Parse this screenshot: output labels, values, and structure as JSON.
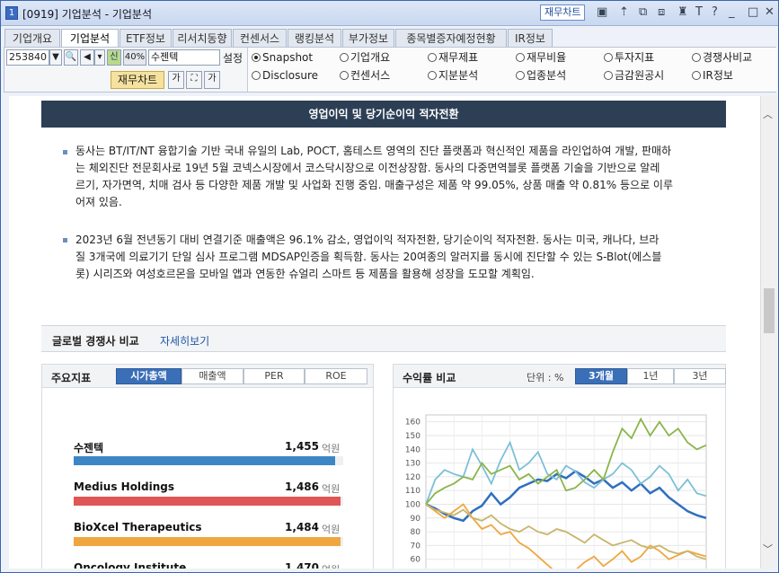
{
  "window": {
    "number": "1",
    "title": "[0919] 기업분석 - 기업분석",
    "finance_chart_btn": "재무차트",
    "icons": [
      "chart-icon",
      "link-icon",
      "tile-icon",
      "window-icon",
      "pin-icon",
      "text-icon",
      "help-icon",
      "minimize-icon",
      "maximize-icon",
      "close-icon"
    ],
    "icon_glyphs": [
      "▣",
      "⇡",
      "⧉",
      "⧈",
      "♜",
      "T",
      "?",
      "_",
      "□",
      "✕"
    ]
  },
  "tabs": [
    "기업개요",
    "기업분석",
    "ETF정보",
    "리서치동향",
    "컨센서스",
    "랭킹분석",
    "부가정보",
    "종목별증자예정현황",
    "IR정보"
  ],
  "toolbar": {
    "code": "253840",
    "badge_new": "신",
    "percent": "40%",
    "stock_name": "수젠텍",
    "settings": "설정",
    "finance_chart": "재무차트"
  },
  "radios": [
    {
      "label": "Snapshot",
      "checked": true
    },
    {
      "label": "기업개요",
      "checked": false
    },
    {
      "label": "재무제표",
      "checked": false
    },
    {
      "label": "재무비율",
      "checked": false
    },
    {
      "label": "투자지표",
      "checked": false
    },
    {
      "label": "경쟁사비교",
      "checked": false
    },
    {
      "label": "Disclosure",
      "checked": false
    },
    {
      "label": "컨센서스",
      "checked": false
    },
    {
      "label": "지분분석",
      "checked": false
    },
    {
      "label": "업종분석",
      "checked": false
    },
    {
      "label": "금감원공시",
      "checked": false
    },
    {
      "label": "IR정보",
      "checked": false
    }
  ],
  "section": {
    "title": "영업이익 및 당기순이익 적자전환",
    "para1": [
      "동사는 BT/IT/NT 융합기술 기반 국내 유일의 Lab, POCT, 홈테스트 영역의 진단 플랫폼과 혁신적인 제품을 라인업하여 개발, 판매하",
      "는 체외진단 전문회사로 19년 5월 코넥스시장에서 코스닥시장으로 이전상장함. 동사의 다중면역블롯 플랫폼 기술을 기반으로 알레",
      "르기, 자가면역, 치매 검사 등 다양한 제품 개발 및 사업화 진행 중임. 매출구성은 제품 약 99.05%, 상품 매출 약 0.81% 등으로 이루",
      "어져 있음."
    ],
    "para2": [
      "2023년 6월 전년동기 대비 연결기준 매출액은 96.1% 감소, 영업이익 적자전환, 당기순이익 적자전환. 동사는 미국, 캐나다, 브라",
      "질 3개국에 의료기기 단일 심사 프로그램 MDSAP인증을 획득함. 동사는 20여종의 알러지를 동시에 진단할 수 있는 S-Blot(에스블",
      "롯) 시리즈와 여성호르몬을 모바일 앱과 연동한 슈얼리 스마트 등 제품을 활용해 성장을 도모할 계획임."
    ]
  },
  "global": {
    "title": "글로벌 경쟁사 비교",
    "link": "자세히보기"
  },
  "left_panel": {
    "title": "주요지표",
    "segments": [
      "시가총액",
      "매출액",
      "PER",
      "ROE"
    ],
    "active": 0,
    "unit": "억원",
    "max": 1500,
    "items": [
      {
        "name": "수젠텍",
        "value": "1,455",
        "num": 1455,
        "color": "#3d86c6"
      },
      {
        "name": "Medius Holdings",
        "value": "1,486",
        "num": 1486,
        "color": "#e05555"
      },
      {
        "name": "BioXcel Therapeutics",
        "value": "1,484",
        "num": 1484,
        "color": "#f0a640"
      },
      {
        "name": "Oncology Institute",
        "value": "1,470",
        "num": 1470,
        "color": "#555555"
      }
    ]
  },
  "right_panel": {
    "title": "수익률 비교",
    "unit_label": "단위 : %",
    "segments": [
      "3개월",
      "1년",
      "3년"
    ],
    "active": 0
  },
  "chart_data": {
    "type": "line",
    "ylim": [
      50,
      165
    ],
    "yticks": [
      160,
      150,
      140,
      130,
      120,
      110,
      100,
      90,
      80,
      70,
      60,
      50
    ],
    "grid": true,
    "series": [
      {
        "color": "#2f6fc0",
        "values": [
          100,
          97,
          93,
          90,
          88,
          95,
          99,
          108,
          100,
          105,
          112,
          115,
          118,
          117,
          122,
          119,
          124,
          120,
          115,
          118,
          112,
          116,
          110,
          115,
          108,
          112,
          105,
          100,
          95,
          92,
          90
        ]
      },
      {
        "color": "#7cc0d8",
        "values": [
          100,
          118,
          125,
          122,
          120,
          140,
          128,
          115,
          132,
          145,
          125,
          130,
          138,
          122,
          118,
          128,
          124,
          116,
          112,
          118,
          122,
          130,
          125,
          115,
          120,
          128,
          122,
          110,
          118,
          108,
          106
        ]
      },
      {
        "color": "#8bb54a",
        "values": [
          100,
          108,
          112,
          115,
          120,
          118,
          130,
          122,
          125,
          128,
          118,
          122,
          115,
          120,
          125,
          110,
          112,
          118,
          125,
          118,
          138,
          155,
          148,
          162,
          150,
          160,
          150,
          155,
          145,
          140,
          143
        ]
      },
      {
        "color": "#f0a640",
        "values": [
          100,
          95,
          90,
          95,
          100,
          90,
          82,
          85,
          78,
          80,
          72,
          68,
          62,
          56,
          50,
          48,
          52,
          58,
          62,
          55,
          60,
          66,
          58,
          62,
          70,
          66,
          60,
          63,
          66,
          64,
          62
        ]
      },
      {
        "color": "#c9b56a",
        "values": [
          100,
          96,
          94,
          92,
          96,
          90,
          88,
          92,
          86,
          82,
          80,
          84,
          80,
          78,
          82,
          80,
          76,
          72,
          78,
          74,
          70,
          72,
          74,
          70,
          68,
          70,
          66,
          64,
          66,
          62,
          60
        ]
      }
    ]
  }
}
